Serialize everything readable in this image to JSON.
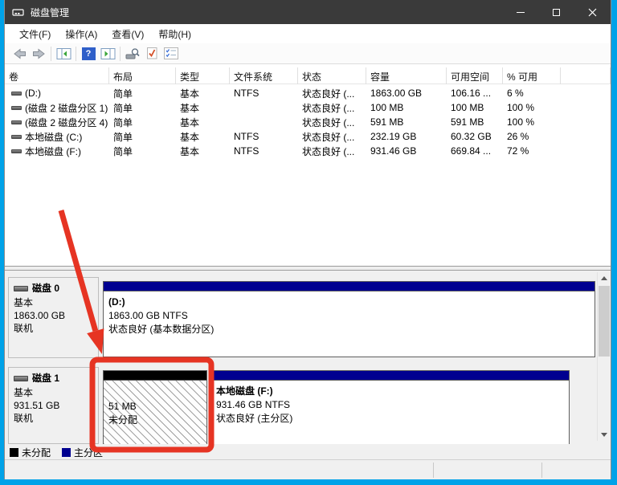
{
  "window": {
    "title": "磁盘管理"
  },
  "menu": {
    "items": [
      "文件(F)",
      "操作(A)",
      "查看(V)",
      "帮助(H)"
    ]
  },
  "toolbar": {
    "help_glyph": "?"
  },
  "volume_table": {
    "columns": [
      "卷",
      "布局",
      "类型",
      "文件系统",
      "状态",
      "容量",
      "可用空间",
      "% 可用"
    ],
    "rows": [
      {
        "name": "(D:)",
        "layout": "简单",
        "type": "基本",
        "fs": "NTFS",
        "status": "状态良好 (...",
        "capacity": "1863.00 GB",
        "free": "106.16 ...",
        "free_pct": "6 %"
      },
      {
        "name": "(磁盘 2 磁盘分区 1)",
        "layout": "简单",
        "type": "基本",
        "fs": "",
        "status": "状态良好 (...",
        "capacity": "100 MB",
        "free": "100 MB",
        "free_pct": "100 %"
      },
      {
        "name": "(磁盘 2 磁盘分区 4)",
        "layout": "简单",
        "type": "基本",
        "fs": "",
        "status": "状态良好 (...",
        "capacity": "591 MB",
        "free": "591 MB",
        "free_pct": "100 %"
      },
      {
        "name": "本地磁盘 (C:)",
        "layout": "简单",
        "type": "基本",
        "fs": "NTFS",
        "status": "状态良好 (...",
        "capacity": "232.19 GB",
        "free": "60.32 GB",
        "free_pct": "26 %"
      },
      {
        "name": "本地磁盘 (F:)",
        "layout": "简单",
        "type": "基本",
        "fs": "NTFS",
        "status": "状态良好 (...",
        "capacity": "931.46 GB",
        "free": "669.84 ...",
        "free_pct": "72 %"
      }
    ]
  },
  "disks": [
    {
      "label": "磁盘 0",
      "kind": "基本",
      "size": "1863.00 GB",
      "state": "联机",
      "partitions": [
        {
          "name": "(D:)",
          "size_fs": "1863.00 GB NTFS",
          "status": "状态良好 (基本数据分区)"
        }
      ]
    },
    {
      "label": "磁盘 1",
      "kind": "基本",
      "size": "931.51 GB",
      "state": "联机",
      "partitions": [
        {
          "size": "51 MB",
          "status": "未分配"
        },
        {
          "name": "本地磁盘  (F:)",
          "size_fs": "931.46 GB NTFS",
          "status": "状态良好 (主分区)"
        }
      ]
    }
  ],
  "legend": {
    "unallocated_label": "未分配",
    "primary_label": "主分区"
  },
  "colors": {
    "titlebar": "#3a3a3a",
    "desktop_blue": "#00a2e8",
    "primary_partition_bar": "#000090",
    "unallocated_bar": "#000000",
    "annotation_red": "#e63423"
  }
}
